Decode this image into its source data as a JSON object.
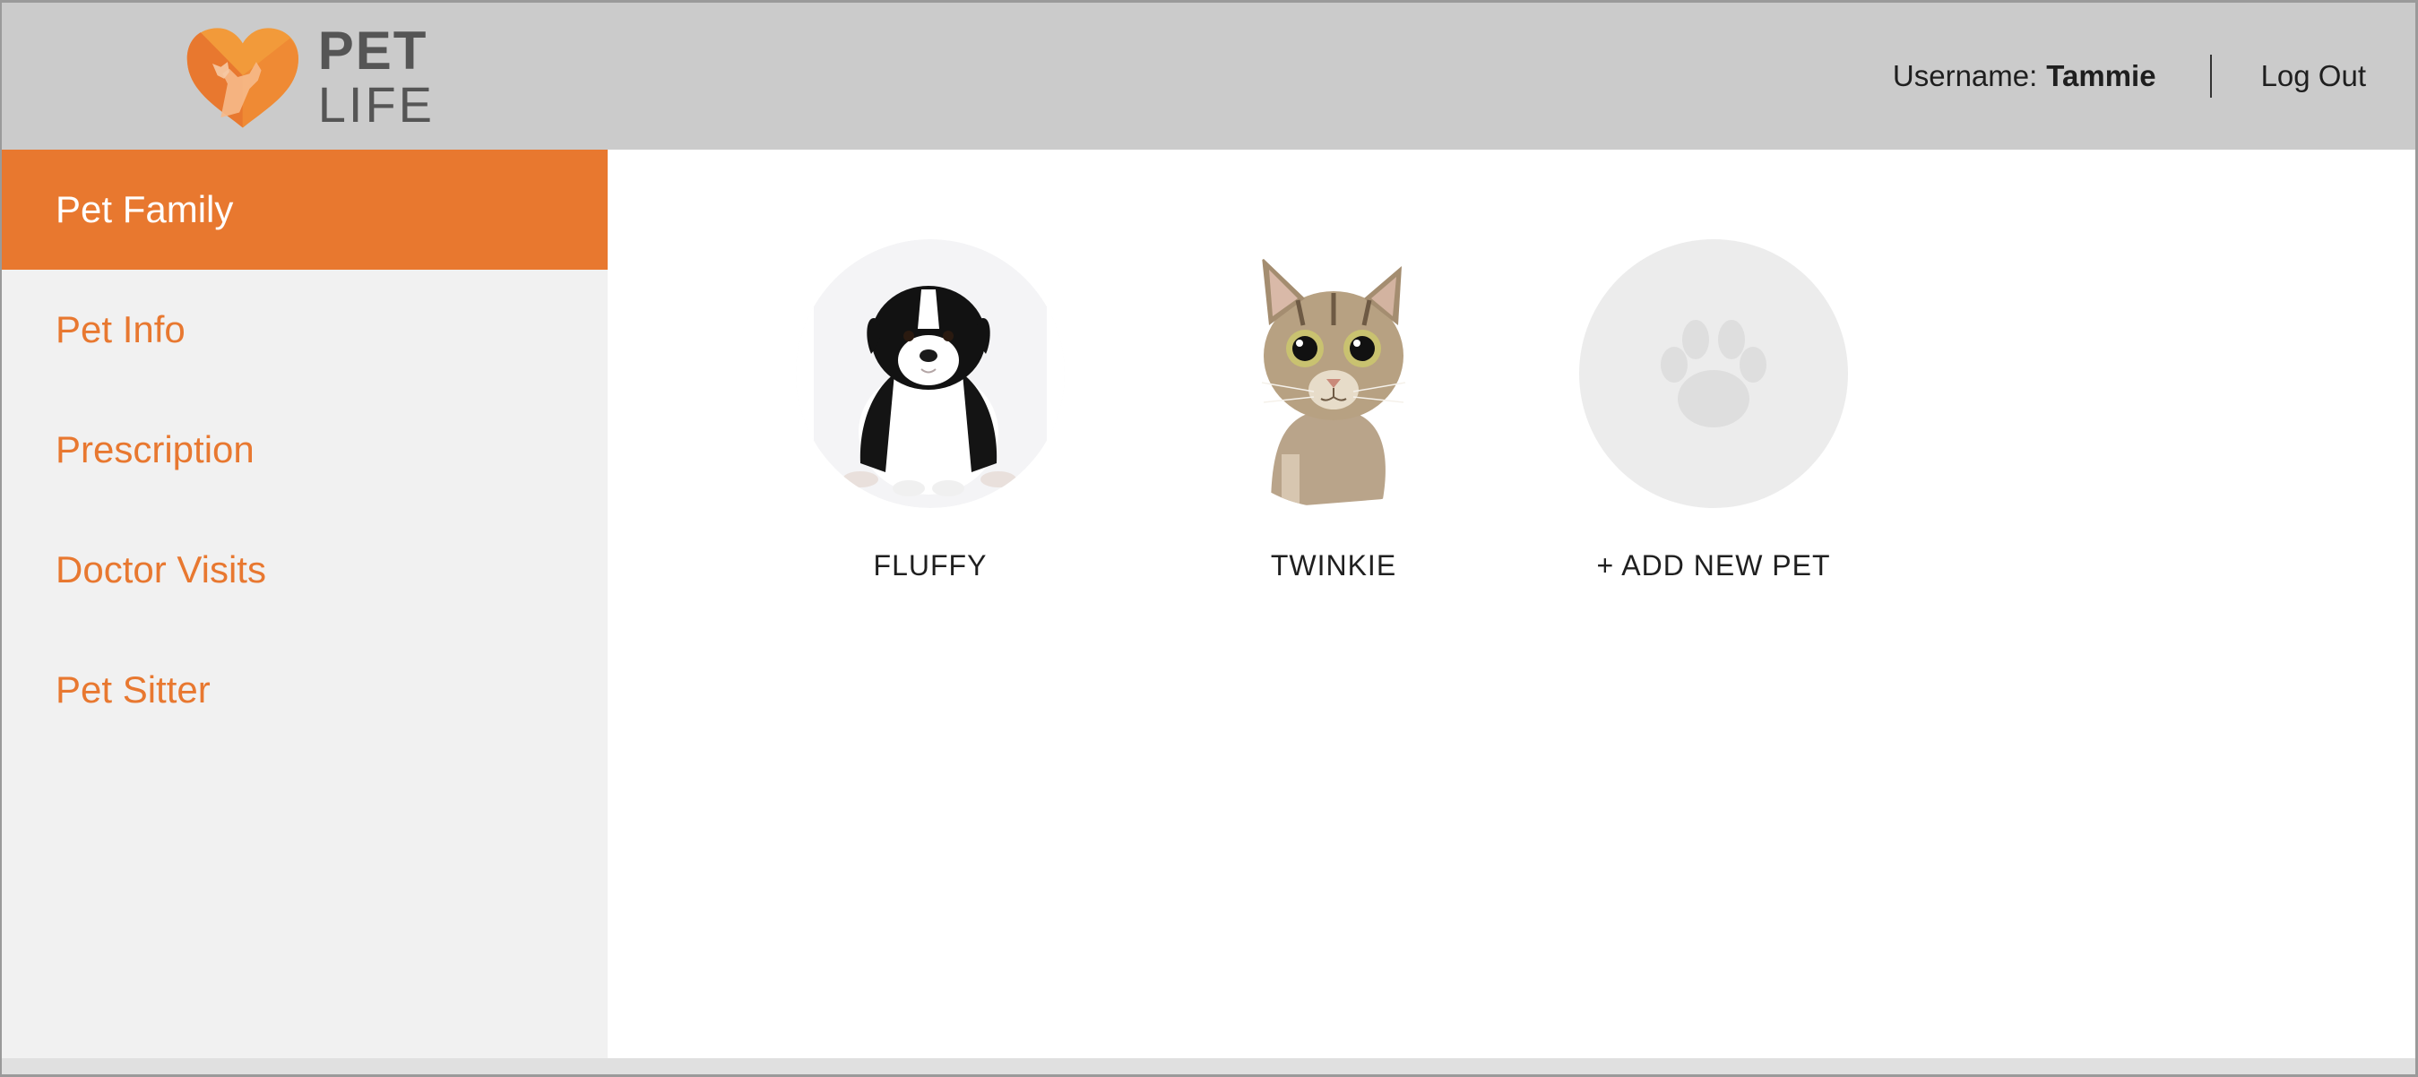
{
  "brand": {
    "line1": "PET",
    "line2": "LIFE",
    "accent_color": "#e8782f",
    "icon": "heart-pet-logo-icon"
  },
  "header": {
    "username_label": "Username:",
    "username_value": "Tammie",
    "logout_label": "Log Out"
  },
  "sidebar": {
    "items": [
      {
        "label": "Pet Family",
        "active": true
      },
      {
        "label": "Pet Info",
        "active": false
      },
      {
        "label": "Prescription",
        "active": false
      },
      {
        "label": "Doctor Visits",
        "active": false
      },
      {
        "label": "Pet Sitter",
        "active": false
      }
    ]
  },
  "pets": [
    {
      "name": "FLUFFY",
      "image": "puppy-photo"
    },
    {
      "name": "TWINKIE",
      "image": "cat-photo"
    }
  ],
  "add_pet": {
    "label": "+ ADD NEW PET",
    "icon": "paw-icon"
  }
}
